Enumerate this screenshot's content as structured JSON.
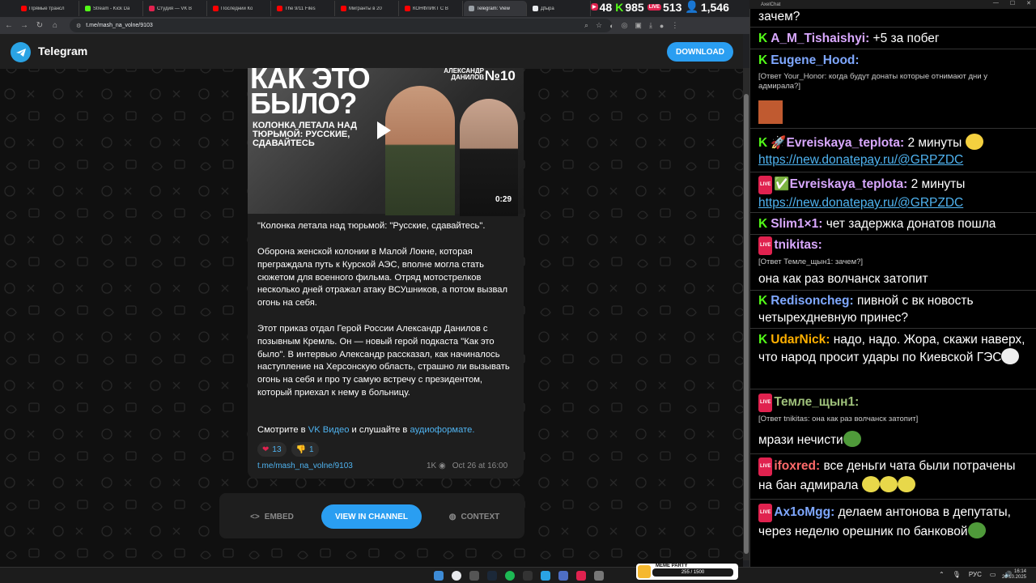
{
  "browser": {
    "tabs": [
      {
        "label": "Прямые трансл",
        "color": "#ff0000"
      },
      {
        "label": "Stream - Kick Da",
        "color": "#53fc18"
      },
      {
        "label": "Студия — VK В",
        "color": "#e0224f"
      },
      {
        "label": "Последний Ко",
        "color": "#ff0000"
      },
      {
        "label": "The 9/11 Files",
        "color": "#ff0000"
      },
      {
        "label": "Мигранты в 20",
        "color": "#ff0000"
      },
      {
        "label": "КОНФЛИКТ С В",
        "color": "#ff0000"
      },
      {
        "label": "Telegram: View",
        "color": "#9aa0a6"
      },
      {
        "label": "Дfыра",
        "color": "#e8eaed"
      }
    ],
    "url": "t.me/mash_na_volne/9103"
  },
  "overlay": {
    "views": "48",
    "kick_count": "985",
    "live_count": "513",
    "followers": "1,546"
  },
  "telegram": {
    "brand": "Telegram",
    "download_label": "DOWNLOAD",
    "video": {
      "title": "КАК ЭТО БЫЛО?",
      "subtitle": "КОЛОНКА ЛЕТАЛА НАД ТЮРЬМОЙ: РУССКИЕ, СДАВАЙТЕСЬ",
      "guest": "АЛЕКСАНДР ДАНИЛОВ",
      "number": "№10",
      "duration": "0:29"
    },
    "post": {
      "headline": "\"Колонка летала над тюрьмой: \"Русские, сдавайтесь\".",
      "para1": "Оборона женской колонии в Малой Локне, которая преграждала путь к Курской АЭС, вполне могла стать сюжетом для военного фильма. Отряд мотострелков несколько дней отражал атаку ВСУшников, а потом вызвал огонь на себя.",
      "para2": "Этот приказ отдал Герой России Александр Данилов с позывным Кремль. Он — новый герой подкаста \"Как это было\". В интервью Александр рассказал, как начиналось наступление на Херсонскую область, страшно ли вызывать огонь на себя и про ту самую встречу с президентом, который приехал к нему в больницу.",
      "watch_prefix": "Смотрите в ",
      "watch_link": "VK Видео",
      "watch_mid": " и слушайте в ",
      "watch_link2": "аудиоформате.",
      "reaction_heart": "13",
      "reaction_thumb": "1",
      "link": "t.me/mash_na_volne/9103",
      "views": "1K",
      "date": "Oct 26 at 16:00"
    },
    "actions": {
      "embed": "EMBED",
      "view": "VIEW IN CHANNEL",
      "context": "CONTEXT"
    }
  },
  "chat": {
    "window_title": "AxelChat",
    "top_text": "зачем?",
    "messages": [
      {
        "platform": "kick",
        "author": "A_M_Tishaishyi",
        "color": "#d9a8ff",
        "text": "+5 за побег"
      },
      {
        "platform": "kick",
        "author": "Eugene_Hood",
        "color": "#7fa8ff",
        "reply": "[Ответ Your_Honor: когда будут донаты которые отнимают дни у адмирала?]",
        "text": ""
      },
      {
        "platform": "kick",
        "author": "Evreiskaya_teplota",
        "color": "#d9a8ff",
        "text": "2 минуты",
        "link": "https://new.donatepay.ru/@GRPZDC"
      },
      {
        "platform": "live",
        "author": "Evreiskaya_teplota",
        "color": "#d9a8ff",
        "text": "2 минуты",
        "link": "https://new.donatepay.ru/@GRPZDC"
      },
      {
        "platform": "kick",
        "author": "Slim1×1",
        "color": "#d9a8ff",
        "text": "чет задержка донатов пошла"
      },
      {
        "platform": "live",
        "author": "tnikitas",
        "color": "#d9a8ff",
        "reply": "[Ответ Темле_щын1: зачем?]",
        "text": "она как раз волчанск затопит"
      },
      {
        "platform": "kick",
        "author": "Redisoncheg",
        "color": "#7fa8ff",
        "text": "пивной с вк новость четырехдневную принес?"
      },
      {
        "platform": "kick",
        "author": "UdarNick",
        "color": "#ffb000",
        "text": "надо, надо. Жора, скажи наверх, что народ просит удары по Киевской ГЭС"
      },
      {
        "platform": "live",
        "author": "Темле_щын1",
        "color": "#9ec07a",
        "reply": "[Ответ tnikitas: она как раз волчанск затопит]",
        "text": "мрази нечисти"
      },
      {
        "platform": "live",
        "author": "ifoxred",
        "color": "#ff6a6a",
        "text": "все деньги чата были потрачены на бан адмирала"
      },
      {
        "platform": "live",
        "author": "Ax1oMgg",
        "color": "#7fa8ff",
        "text": "делаем антонова в депутаты, через неделю орешник по банковой"
      }
    ]
  },
  "taskbar": {
    "time": "16:14",
    "date": "26.10.2025",
    "lang": "РУС",
    "meme_title": "MEME PARTY",
    "meme_progress": "255 / 1500"
  }
}
